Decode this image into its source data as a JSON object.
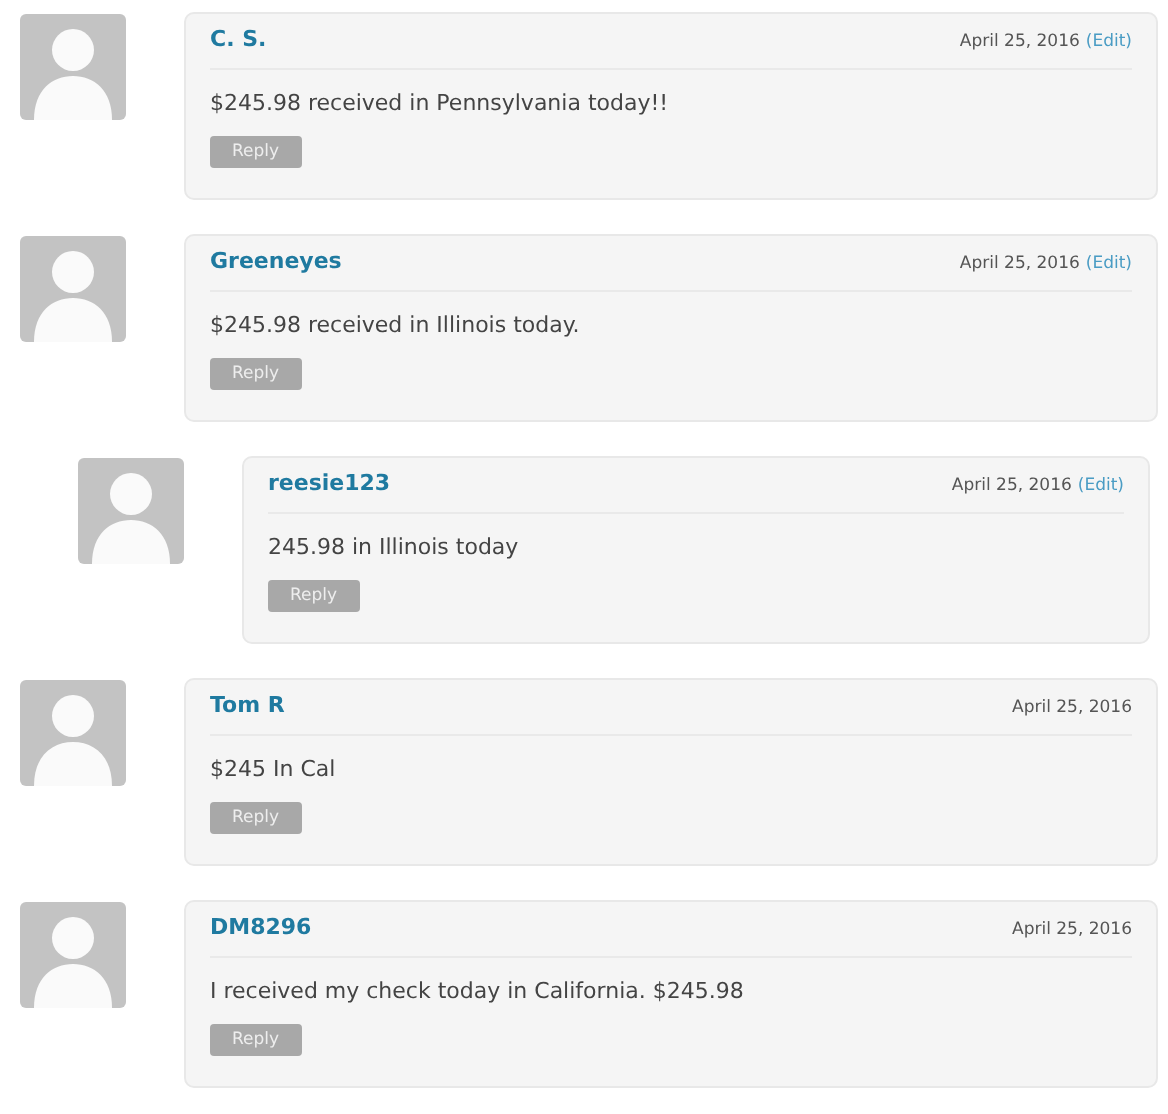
{
  "comments": [
    {
      "author": "C. S.",
      "date": "April 25, 2016",
      "edit": "(Edit)",
      "text": "$245.98 received in Pennsylvania today!!",
      "reply": "Reply"
    },
    {
      "author": "Greeneyes",
      "date": "April 25, 2016",
      "edit": "(Edit)",
      "text": "$245.98 received in Illinois today.",
      "reply": "Reply",
      "children": [
        {
          "author": "reesie123",
          "date": "April 25, 2016",
          "edit": "(Edit)",
          "text": "245.98 in Illinois today",
          "reply": "Reply"
        }
      ]
    },
    {
      "author": "Tom R",
      "date": "April 25, 2016",
      "text": "$245 In Cal",
      "reply": "Reply"
    },
    {
      "author": "DM8296",
      "date": "April 25, 2016",
      "text": "I received my check today in California. $245.98",
      "reply": "Reply"
    }
  ]
}
